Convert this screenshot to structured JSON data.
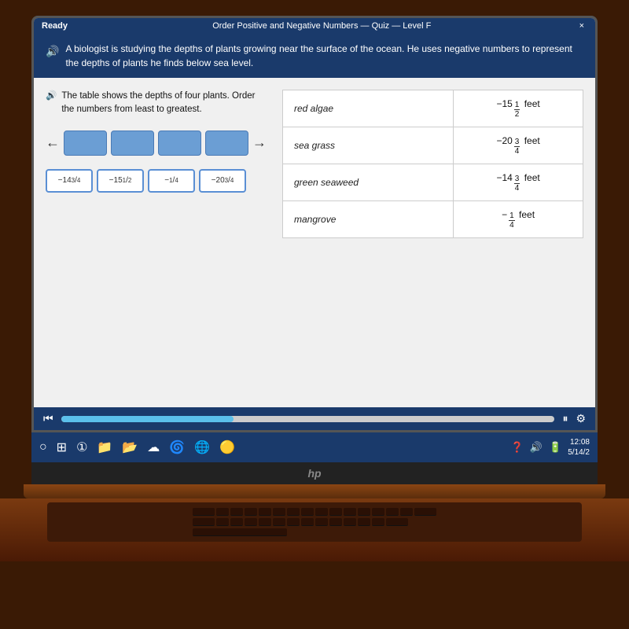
{
  "titleBar": {
    "left": "Ready",
    "center": "Order Positive and Negative Numbers — Quiz — Level F",
    "closeBtn": "×"
  },
  "headerQuestion": {
    "speakerIcon": "🔊",
    "text": "A biologist is studying the depths of plants growing near the surface of the ocean. He uses negative numbers to represent the depths of plants he finds below sea level."
  },
  "subQuestion": {
    "speakerIcon": "🔊",
    "text": "The table shows the depths of four plants. Order the numbers from least to greatest."
  },
  "answerBoxes": [
    {
      "label": "-14¾"
    },
    {
      "label": "-15½"
    },
    {
      "label": "-¼"
    },
    {
      "label": "-20¾"
    }
  ],
  "table": {
    "rows": [
      {
        "plant": "red algae",
        "value": "-15½ feet",
        "whole": "-15",
        "num": "1",
        "den": "2",
        "unit": "feet"
      },
      {
        "plant": "sea grass",
        "value": "-20¾ feet",
        "whole": "-20",
        "num": "3",
        "den": "4",
        "unit": "feet"
      },
      {
        "plant": "green seaweed",
        "value": "-14¾ feet",
        "whole": "-14",
        "num": "3",
        "den": "4",
        "unit": "feet"
      },
      {
        "plant": "mangrove",
        "value": "-¼ feet",
        "whole": "-",
        "num": "1",
        "den": "4",
        "unit": "feet"
      }
    ]
  },
  "mediaBar": {
    "playIcon": "⏮",
    "progressPercent": 35,
    "pauseIcon": "⏸",
    "settingsIcon": "⚙"
  },
  "taskbar": {
    "icons": [
      "⊞",
      "⊟",
      "🗀",
      "☁",
      "🌀",
      "🌐",
      "🟡"
    ],
    "clock": "12:08",
    "date": "5/14/2"
  },
  "hpLogo": "hp"
}
